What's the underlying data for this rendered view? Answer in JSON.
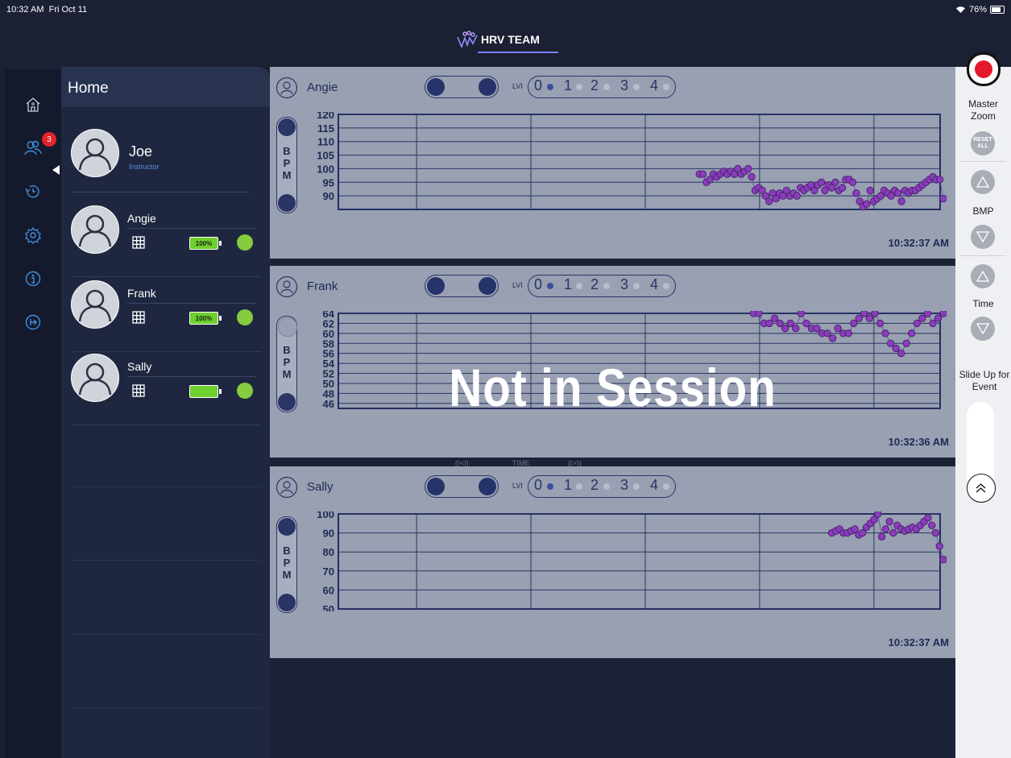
{
  "status_bar": {
    "time": "10:32 AM",
    "date": "Fri Oct 11",
    "battery": "76%"
  },
  "brand": {
    "name": "HRV TEAM"
  },
  "nav": {
    "badge": "3"
  },
  "home": {
    "title": "Home",
    "instructor": {
      "name": "Joe",
      "role": "Instructor"
    },
    "members": [
      {
        "name": "Angie",
        "battery": "100%"
      },
      {
        "name": "Frank",
        "battery": "100%"
      },
      {
        "name": "Sally",
        "battery": ""
      }
    ]
  },
  "charts": {
    "lvi_label": "LVI",
    "lvi_levels": [
      "0",
      "1",
      "2",
      "3",
      "4"
    ],
    "ylabel": [
      "B",
      "P",
      "M"
    ],
    "time_nav": {
      "prev": "((<|)",
      "label": "TIME",
      "next": "(|>))"
    },
    "overlay": "Not in Session",
    "panels": [
      {
        "name": "Angie",
        "timestamp": "10:32:37 AM"
      },
      {
        "name": "Frank",
        "timestamp": "10:32:36 AM"
      },
      {
        "name": "Sally",
        "timestamp": "10:32:37 AM"
      }
    ]
  },
  "chart_data": [
    {
      "type": "scatter",
      "title": "Angie",
      "ylabel": "BPM",
      "yticks": [
        90,
        95,
        100,
        105,
        110,
        115,
        120
      ],
      "ylim": [
        85,
        120
      ],
      "grid": true,
      "x": [
        0,
        1,
        2,
        3,
        4,
        5,
        6,
        7,
        8,
        9,
        10,
        11,
        12,
        13,
        14,
        15,
        16,
        17,
        18,
        19,
        20,
        21,
        22,
        23,
        24,
        25,
        26,
        27,
        28,
        29,
        30,
        31,
        32,
        33,
        34,
        35,
        36,
        37,
        38,
        39,
        40,
        41,
        42,
        43,
        44,
        45,
        46,
        47,
        48,
        49,
        50,
        51,
        52,
        53,
        54,
        55,
        56,
        57,
        58,
        59,
        60,
        61,
        62,
        63,
        64,
        65,
        66,
        67,
        68,
        69,
        70
      ],
      "y": [
        98,
        98,
        95,
        96,
        98,
        97,
        98,
        99,
        98,
        99,
        98,
        100,
        98,
        99,
        100,
        97,
        92,
        93,
        92,
        90,
        88,
        91,
        89,
        91,
        90,
        92,
        90,
        91,
        90,
        93,
        92,
        93,
        94,
        92,
        94,
        95,
        92,
        94,
        93,
        95,
        92,
        93,
        96,
        96,
        95,
        91,
        88,
        86,
        87,
        92,
        88,
        89,
        90,
        92,
        91,
        90,
        92,
        91,
        88,
        92,
        91,
        92,
        92,
        93,
        94,
        95,
        96,
        97,
        96,
        96,
        89
      ]
    },
    {
      "type": "scatter",
      "title": "Frank",
      "ylabel": "BPM",
      "yticks": [
        46,
        48,
        50,
        52,
        54,
        56,
        58,
        60,
        62,
        64
      ],
      "ylim": [
        45,
        64
      ],
      "grid": true,
      "x": [
        0,
        1,
        2,
        3,
        4,
        5,
        6,
        7,
        8,
        9,
        10,
        11,
        12,
        13,
        14,
        15,
        16,
        17,
        18,
        19,
        20,
        21,
        22,
        23,
        24,
        25,
        26,
        27,
        28,
        29,
        30,
        31,
        32,
        33,
        34,
        35,
        36
      ],
      "y": [
        64,
        64,
        62,
        62,
        63,
        62,
        61,
        62,
        61,
        64,
        62,
        61,
        61,
        60,
        60,
        59,
        61,
        60,
        60,
        62,
        63,
        64,
        63,
        64,
        62,
        60,
        58,
        57,
        56,
        58,
        60,
        62,
        63,
        64,
        62,
        63,
        64
      ]
    },
    {
      "type": "scatter",
      "title": "Sally",
      "ylabel": "BPM",
      "yticks": [
        50,
        60,
        70,
        80,
        90,
        100
      ],
      "ylim": [
        50,
        100
      ],
      "grid": true,
      "x": [
        0,
        1,
        2,
        3,
        4,
        5,
        6,
        7,
        8,
        9,
        10,
        11,
        12,
        13,
        14,
        15,
        16,
        17,
        18,
        19,
        20,
        21,
        22,
        23,
        24,
        25,
        26,
        27,
        28,
        29
      ],
      "y": [
        90,
        91,
        92,
        90,
        90,
        91,
        92,
        89,
        90,
        93,
        95,
        97,
        100,
        88,
        92,
        96,
        90,
        94,
        92,
        91,
        92,
        93,
        92,
        94,
        96,
        98,
        94,
        90,
        83,
        76
      ]
    }
  ],
  "right_panel": {
    "master_zoom": "Master Zoom",
    "reset": "RESET ALL",
    "bmp": "BMP",
    "time": "Time",
    "slide_up": "Slide Up for Event"
  },
  "colors": {
    "accent": "#7b80ff",
    "plot_dot": "#8a3dbb",
    "record": "#e4192c",
    "battery": "#6fcf2e"
  }
}
